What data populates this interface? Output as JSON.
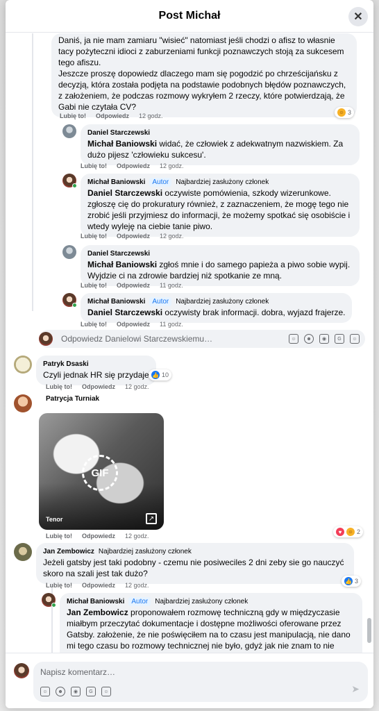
{
  "modal": {
    "title": "Post Michał",
    "close_label": "✕"
  },
  "actions": {
    "like": "Lubię to!",
    "reply": "Odpowiedz"
  },
  "badges": {
    "author": "Autor",
    "member": "Najbardziej zasłużony członek"
  },
  "comments": {
    "c0": {
      "text": "Daniś, ja nie mam zamiaru \"wisieć\" natomiast jeśli chodzi o afisz to własnie tacy pożyteczni idioci z zaburzeniami funkcji poznawczych stoją za sukcesem tego afiszu.\nJeszcze proszę dopowiedz dlaczego mam się pogodzić po chrześcijańsku z decyzją, która została podjęta na podstawie podobnych błędów poznawczych, z założeniem, że podczas rozmowy wykryłem 2 rzeczy, które potwierdzają, że Gabi nie czytała CV?",
      "time": "12 godz.",
      "reaction_count": "3"
    },
    "c1": {
      "author": "Daniel Starczewski",
      "mention": "Michał Baniowski",
      "text": " widać, że człowiek z adekwatnym nazwiskiem. Za dużo pijesz 'człowieku sukcesu'.",
      "time": "12 godz."
    },
    "c2": {
      "author": "Michał Baniowski",
      "mention": "Daniel Starczewski",
      "text": " oczywiste pomówienia, szkody wizerunkowe. zgłoszę cię do prokuratury również, z zaznaczeniem, że mogę tego nie zrobić jeśli przyjmiesz do informacji, że możemy spotkać się osobiście i wtedy wyleję na ciebie tanie piwo.",
      "time": "12 godz."
    },
    "c3": {
      "author": "Daniel Starczewski",
      "mention": "Michał Baniowski",
      "text": " zgłoś mnie i do samego papieża a piwo sobie wypij. Wyjdzie ci na zdrowie bardziej niż spotkanie ze mną.",
      "time": "11 godz."
    },
    "c4": {
      "author": "Michał Baniowski",
      "mention": "Daniel Starczewski",
      "text": " oczywisty brak informacji. dobra, wyjazd frajerze.",
      "time": "11 godz."
    },
    "c5": {
      "author": "Patryk Dsaski",
      "text": "Czyli jednak HR się przydaje",
      "time": "12 godz.",
      "reaction_count": "10"
    },
    "c6": {
      "author": "Patrycja Turniak",
      "gif_label": "GIF",
      "gif_source": "Tenor",
      "time": "12 godz.",
      "reaction_count": "2"
    },
    "c7": {
      "author": "Jan Zembowicz",
      "text": "Jeżeli gatsby jest taki podobny - czemu nie posiweciles 2 dni zeby sie go nauczyć skoro na szali jest tak dużo?",
      "time": "12 godz.",
      "reaction_count": "3"
    },
    "c8": {
      "author": "Michał Baniowski",
      "mention": "Jan Zembowicz",
      "text": " proponowałem rozmowę techniczną gdy w międzyczasie miałbym przeczytać dokumentacje i dostępne możliwości oferowane przez Gatsby. założenie, że nie poświęciłem na to czasu jest manipulacją, nie dano mi tego czasu bo rozmowy technicznej nie było, gdyż jak nie znam to nie znam, no trudno, szukaja kogoś kto zna. pochyl głowe, nadstaw policzek, pogódź się z tym,"
    }
  },
  "reply_box": {
    "placeholder": "Odpowiedz Danielowi Starczewskiemu…"
  },
  "composer": {
    "placeholder": "Napisz komentarz…"
  }
}
